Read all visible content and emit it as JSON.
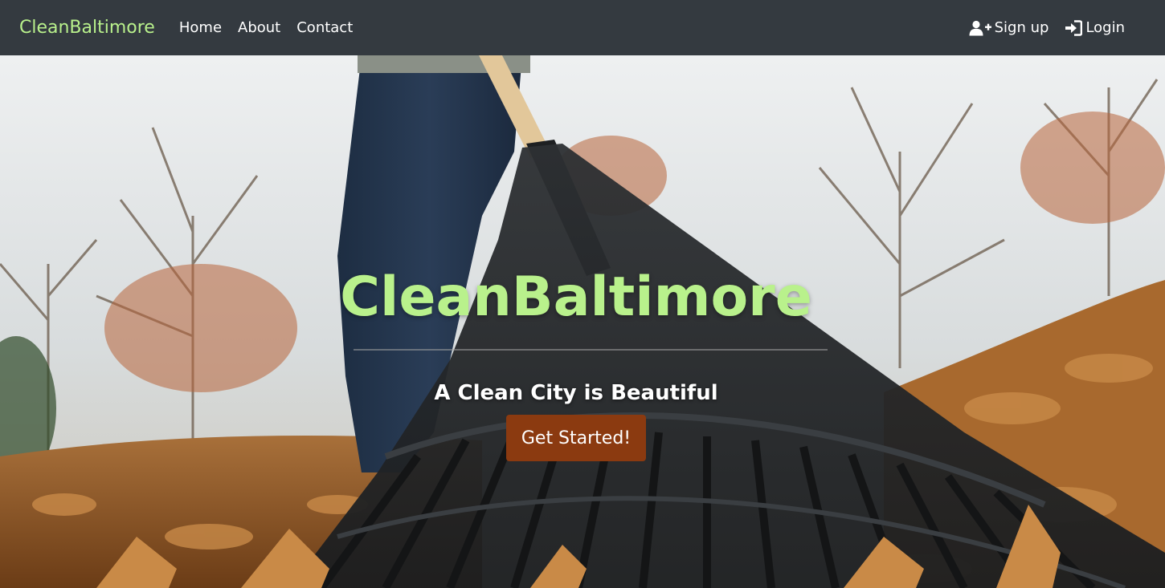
{
  "navbar": {
    "brand": "CleanBaltimore",
    "links": [
      {
        "label": "Home"
      },
      {
        "label": "About"
      },
      {
        "label": "Contact"
      }
    ],
    "signup": {
      "label": "Sign up",
      "icon": "user-plus-icon"
    },
    "login": {
      "label": "Login",
      "icon": "sign-in-icon"
    }
  },
  "hero": {
    "background": "autumn-park-rake-leaves-photo",
    "title": "CleanBaltimore",
    "subtitle": "A Clean City is Beautiful",
    "cta_label": "Get Started!"
  },
  "colors": {
    "navbar_bg": "#343a40",
    "brand_accent": "#b9f18c",
    "cta_bg": "#8b3a10"
  }
}
